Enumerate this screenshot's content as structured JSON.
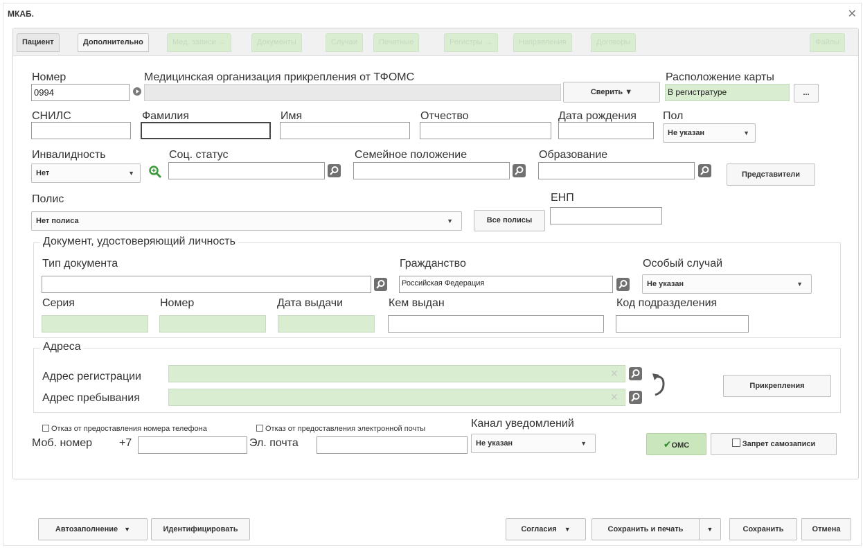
{
  "window": {
    "title": "МКАБ."
  },
  "tabs": [
    "Пациент",
    "Дополнительно",
    "Мед. записи →",
    "Документы",
    "Случаи",
    "Печатные",
    "Регистры →",
    "Направления",
    "Договоры",
    "Файлы"
  ],
  "fields": {
    "number_label": "Номер",
    "number_value": "0994",
    "mo_label": "Медицинская организация прикрепления от ТФОМС",
    "check_label": "Сверить ▼",
    "location_label": "Расположение карты",
    "location_value": "В регистратуре",
    "location_btn": "...",
    "snils_label": "СНИЛС",
    "surname_label": "Фамилия",
    "name_label": "Имя",
    "patronymic_label": "Отчество",
    "birthdate_label": "Дата рождения",
    "sex_label": "Пол",
    "sex_value": "Не указан",
    "disability_label": "Инвалидность",
    "disability_value": "Нет",
    "social_label": "Соц. статус",
    "family_label": "Семейное положение",
    "education_label": "Образование",
    "representatives_btn": "Представители",
    "policy_label": "Полис",
    "policy_value": "Нет полиса",
    "all_policies_btn": "Все полисы",
    "enp_label": "ЕНП"
  },
  "document": {
    "legend": "Документ, удостоверяющий личность",
    "type_label": "Тип документа",
    "citizenship_label": "Гражданство",
    "citizenship_value": "Российская Федерация",
    "special_label": "Особый случай",
    "special_value": "Не указан",
    "series_label": "Серия",
    "number_label": "Номер",
    "issue_date_label": "Дата выдачи",
    "issued_by_label": "Кем выдан",
    "division_label": "Код подразделения"
  },
  "address": {
    "legend": "Адреса",
    "reg_label": "Адрес регистрации",
    "stay_label": "Адрес пребывания",
    "attach_btn": "Прикрепления"
  },
  "contacts": {
    "refuse_phone": "Отказ от предоставления номера телефона",
    "refuse_email": "Отказ от предоставления электронной почты",
    "channel_label": "Канал уведомлений",
    "channel_value": "Не указан",
    "mobile_label": "Моб. номер",
    "mobile_prefix": "+7",
    "email_label": "Эл. почта",
    "oms_btn": "ОМС",
    "ban_btn": "Запрет самозаписи"
  },
  "footer": {
    "autofill": "Автозаполнение",
    "identify": "Идентифицировать",
    "consents": "Согласия",
    "save_print": "Сохранить и печать",
    "save": "Сохранить",
    "cancel": "Отмена"
  },
  "colors": {
    "readonly_green": "#d9edd0",
    "oms_green": "#c9e6bc",
    "check_mark": "#2e8b2e"
  }
}
